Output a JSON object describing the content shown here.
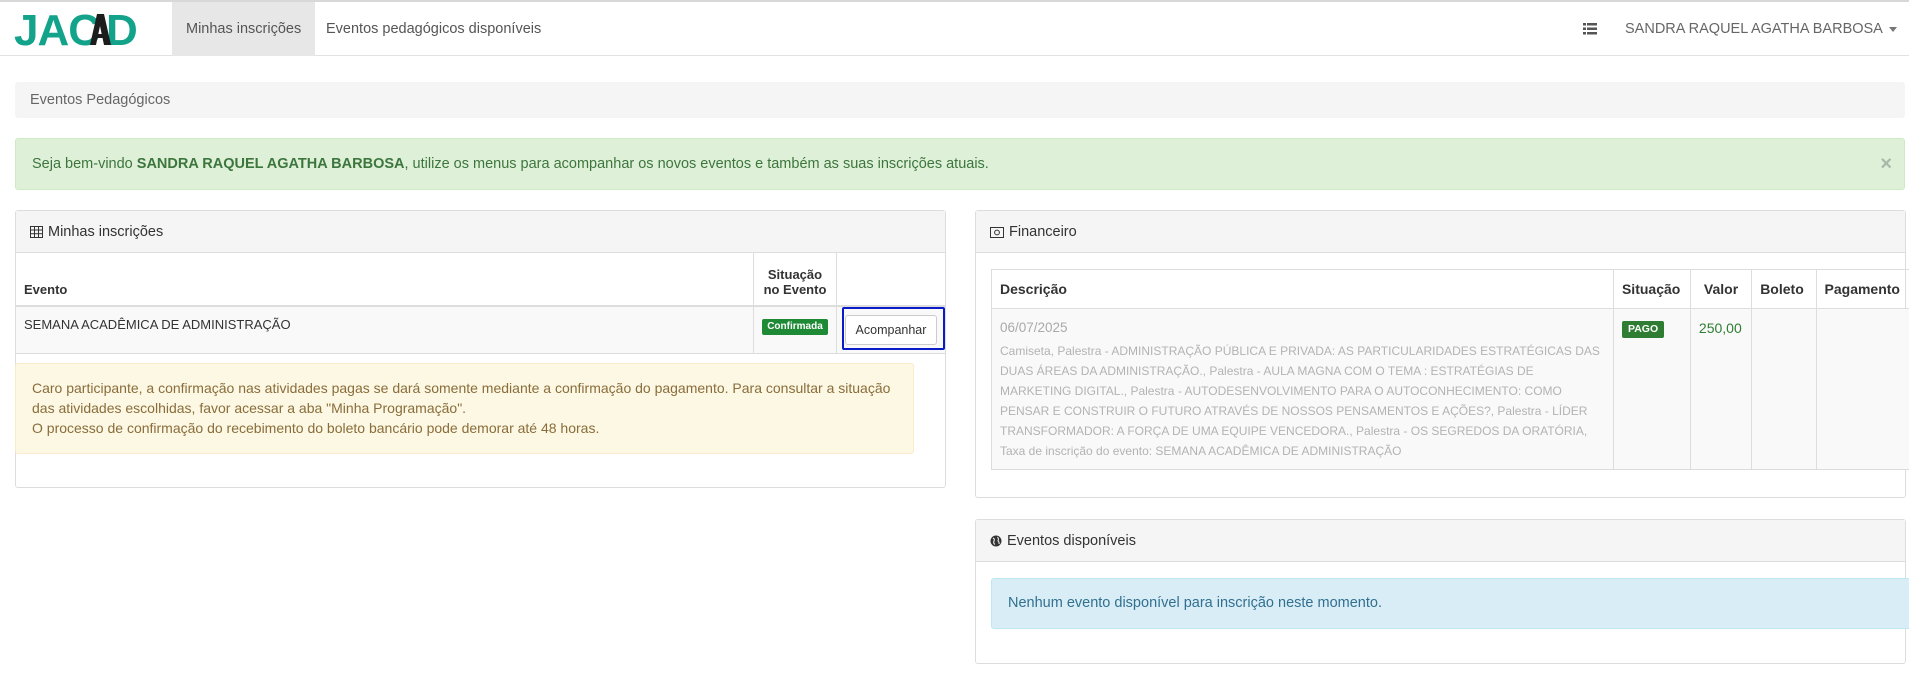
{
  "brand": {
    "logo_text": "JACAD",
    "colors": {
      "teal": "#13a38a",
      "dark": "#1d1d1d"
    }
  },
  "nav": {
    "tabs": [
      {
        "label": "Minhas inscrições",
        "active": true
      },
      {
        "label": "Eventos pedagógicos disponíveis",
        "active": false
      }
    ],
    "list_icon": "list-icon",
    "user_name": "SANDRA RAQUEL AGATHA BARBOSA"
  },
  "breadcrumb": {
    "label": "Eventos Pedagógicos"
  },
  "welcome": {
    "prefix": "Seja bem-vindo ",
    "name": "SANDRA RAQUEL AGATHA BARBOSA",
    "suffix": ", utilize os menus para acompanhar os novos eventos e também as suas inscrições atuais.",
    "close": "×"
  },
  "inscricoes": {
    "title": "Minhas inscrições",
    "icon": "table-icon",
    "headers": {
      "evento": "Evento",
      "situacao_line1": "Situação",
      "situacao_line2": "no Evento"
    },
    "rows": [
      {
        "evento": "SEMANA ACADÊMICA DE ADMINISTRAÇÃO",
        "situacao": "Confirmada",
        "action": "Acompanhar"
      }
    ],
    "notice_line1": "Caro participante, a confirmação nas atividades pagas se dará somente mediante a confirmação do pagamento. Para consultar a situação das atividades escolhidas, favor acessar a aba \"Minha Programação\".",
    "notice_line2": "O processo de confirmação do recebimento do boleto bancário pode demorar até 48 horas."
  },
  "financeiro": {
    "title": "Financeiro",
    "icon": "money-icon",
    "headers": {
      "descricao": "Descrição",
      "situacao": "Situação",
      "valor": "Valor",
      "boleto": "Boleto",
      "pagamento": "Pagamento"
    },
    "rows": [
      {
        "date": "06/07/2025",
        "descricao": "Camiseta, Palestra - ADMINISTRAÇÃO PÚBLICA E PRIVADA: AS PARTICULARIDADES ESTRATÉGICAS DAS DUAS ÁREAS DA ADMINISTRAÇÃO., Palestra - AULA MAGNA COM O TEMA : ESTRATÉGIAS DE MARKETING DIGITAL., Palestra - AUTODESENVOLVIMENTO PARA O AUTOCONHECIMENTO: COMO PENSAR E CONSTRUIR O FUTURO ATRAVÉS DE NOSSOS PENSAMENTOS E AÇÕES?, Palestra - LÍDER TRANSFORMADOR: A FORÇA DE UMA EQUIPE VENCEDORA., Palestra - OS SEGREDOS DA ORATÓRIA, Taxa de inscrição do evento: SEMANA ACADÊMICA DE ADMINISTRAÇÃO",
        "situacao": "PAGO",
        "valor": "250,00",
        "boleto": "",
        "pagamento": ""
      }
    ]
  },
  "eventos": {
    "title": "Eventos disponíveis",
    "icon": "globe-icon",
    "message": "Nenhum evento disponível para inscrição neste momento."
  }
}
